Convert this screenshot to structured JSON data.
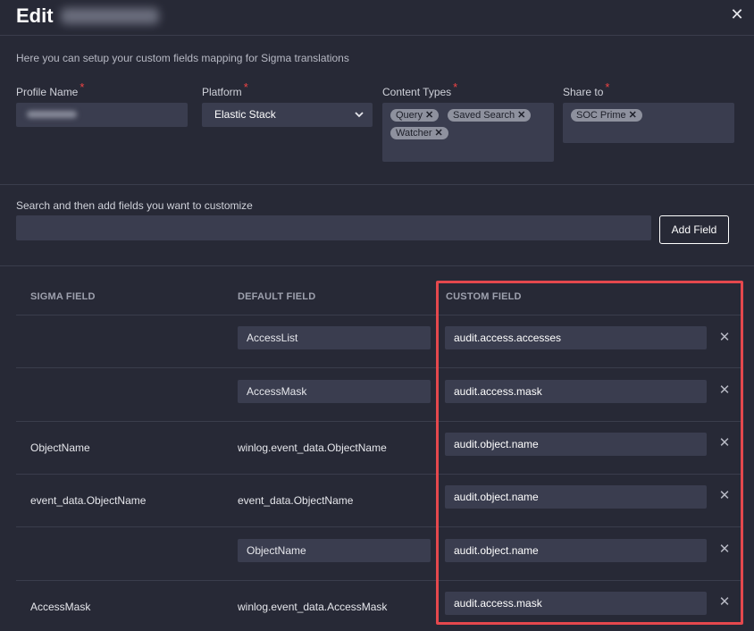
{
  "header": {
    "title": "Edit",
    "close_icon": "close-icon"
  },
  "intro": "Here you can setup your custom fields mapping for Sigma translations",
  "form": {
    "profile_name": {
      "label": "Profile Name",
      "required": "*"
    },
    "platform": {
      "label": "Platform",
      "required": "*",
      "value": "Elastic Stack"
    },
    "content_types": {
      "label": "Content Types",
      "required": "*",
      "chips": [
        "Query",
        "Saved Search",
        "Watcher"
      ]
    },
    "share_to": {
      "label": "Share to",
      "required": "*",
      "chips": [
        "SOC Prime"
      ]
    },
    "chip_remove": "✕"
  },
  "search": {
    "label": "Search and then add fields you want to customize",
    "placeholder": ""
  },
  "add_field_button": "Add Field",
  "table": {
    "headers": {
      "sigma": "SIGMA FIELD",
      "default": "DEFAULT FIELD",
      "custom": "CUSTOM FIELD"
    },
    "rows": [
      {
        "sigma": "",
        "default": "AccessList",
        "default_editable": true,
        "custom": "audit.access.accesses"
      },
      {
        "sigma": "",
        "default": "AccessMask",
        "default_editable": true,
        "custom": "audit.access.mask"
      },
      {
        "sigma": "ObjectName",
        "default": "winlog.event_data.ObjectName",
        "default_editable": false,
        "custom": "audit.object.name"
      },
      {
        "sigma": "event_data.ObjectName",
        "default": "event_data.ObjectName",
        "default_editable": false,
        "custom": "audit.object.name"
      },
      {
        "sigma": "",
        "default": "ObjectName",
        "default_editable": true,
        "custom": "audit.object.name"
      },
      {
        "sigma": "AccessMask",
        "default": "winlog.event_data.AccessMask",
        "default_editable": false,
        "custom": "audit.access.mask"
      }
    ],
    "remove_glyph": "✕"
  },
  "colors": {
    "background": "#272936",
    "input": "#3a3d4f",
    "highlight": "#e5484d",
    "required": "#ef4444"
  }
}
